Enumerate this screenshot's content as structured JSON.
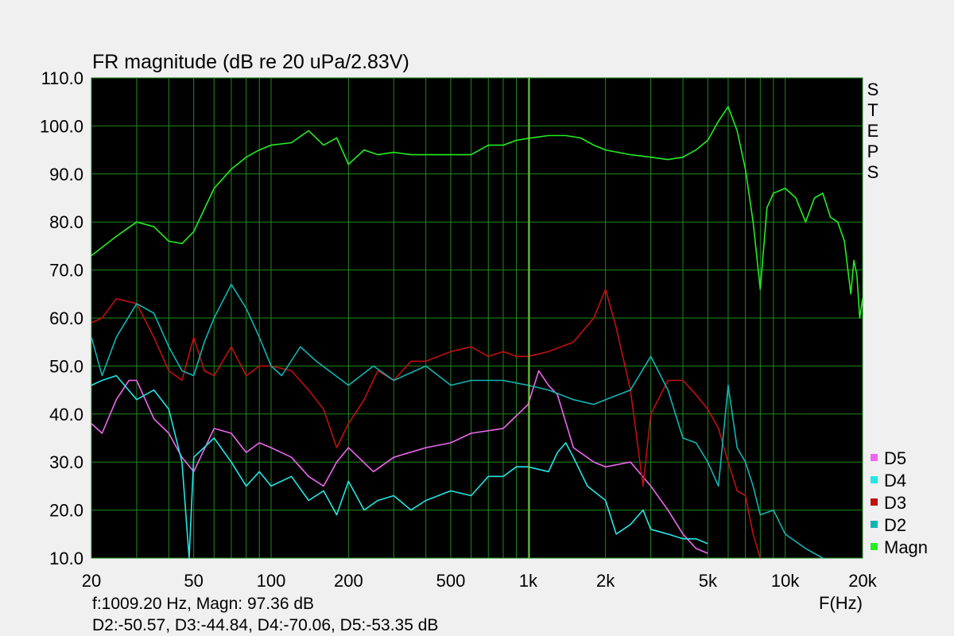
{
  "chart_data": {
    "type": "line",
    "title": "FR magnitude (dB re 20 uPa/2.83V)",
    "xlabel": "F(Hz)",
    "ylabel": "",
    "x_scale": "log",
    "xlim": [
      20,
      20000
    ],
    "ylim": [
      10,
      110
    ],
    "x_ticks": [
      {
        "value": 20,
        "label": "20"
      },
      {
        "value": 50,
        "label": "50"
      },
      {
        "value": 100,
        "label": "100"
      },
      {
        "value": 200,
        "label": "200"
      },
      {
        "value": 500,
        "label": "500"
      },
      {
        "value": 1000,
        "label": "1k"
      },
      {
        "value": 2000,
        "label": "2k"
      },
      {
        "value": 5000,
        "label": "5k"
      },
      {
        "value": 10000,
        "label": "10k"
      },
      {
        "value": 20000,
        "label": "20k"
      }
    ],
    "y_ticks": [
      {
        "value": 110,
        "label": "110.0"
      },
      {
        "value": 100,
        "label": "100.0"
      },
      {
        "value": 90,
        "label": "90.0"
      },
      {
        "value": 80,
        "label": "80.0"
      },
      {
        "value": 70,
        "label": "70.0"
      },
      {
        "value": 60,
        "label": "60.0"
      },
      {
        "value": 50,
        "label": "50.0"
      },
      {
        "value": 40,
        "label": "40.0"
      },
      {
        "value": 30,
        "label": "30.0"
      },
      {
        "value": 20,
        "label": "20.0"
      },
      {
        "value": 10,
        "label": "10.0"
      }
    ],
    "grid": true,
    "background_color": "#000000",
    "grid_color": "#1f8a1f",
    "legend_position": "bottom-right",
    "steps_label": "STEPS",
    "cursor": {
      "x": 1009.2,
      "color": "#9acd32"
    },
    "status_line1": "f:1009.20 Hz, Magn: 97.36 dB",
    "status_line2": "D2:-50.57, D3:-44.84, D4:-70.06, D5:-53.35 dB",
    "series": [
      {
        "name": "Magn",
        "color": "#22ee22",
        "points": [
          [
            20,
            73
          ],
          [
            25,
            77
          ],
          [
            30,
            80
          ],
          [
            35,
            79
          ],
          [
            40,
            76
          ],
          [
            45,
            75.5
          ],
          [
            50,
            78
          ],
          [
            60,
            87
          ],
          [
            70,
            91
          ],
          [
            80,
            93.5
          ],
          [
            90,
            95
          ],
          [
            100,
            96
          ],
          [
            120,
            96.5
          ],
          [
            140,
            99
          ],
          [
            160,
            96
          ],
          [
            180,
            97.5
          ],
          [
            200,
            92
          ],
          [
            230,
            95
          ],
          [
            260,
            94
          ],
          [
            300,
            94.5
          ],
          [
            350,
            94
          ],
          [
            400,
            94
          ],
          [
            450,
            94
          ],
          [
            500,
            94
          ],
          [
            600,
            94
          ],
          [
            700,
            96
          ],
          [
            800,
            96
          ],
          [
            900,
            97
          ],
          [
            1000,
            97.4
          ],
          [
            1200,
            98
          ],
          [
            1400,
            98
          ],
          [
            1600,
            97.5
          ],
          [
            1800,
            96
          ],
          [
            2000,
            95
          ],
          [
            2500,
            94
          ],
          [
            3000,
            93.5
          ],
          [
            3500,
            93
          ],
          [
            4000,
            93.5
          ],
          [
            4500,
            95
          ],
          [
            5000,
            97
          ],
          [
            5500,
            101
          ],
          [
            6000,
            104
          ],
          [
            6500,
            99
          ],
          [
            7000,
            91
          ],
          [
            7500,
            80
          ],
          [
            8000,
            66
          ],
          [
            8500,
            83
          ],
          [
            9000,
            86
          ],
          [
            10000,
            87
          ],
          [
            11000,
            85
          ],
          [
            12000,
            80
          ],
          [
            13000,
            85
          ],
          [
            14000,
            86
          ],
          [
            15000,
            81
          ],
          [
            16000,
            80
          ],
          [
            17000,
            76
          ],
          [
            18000,
            65
          ],
          [
            18500,
            72
          ],
          [
            19000,
            69
          ],
          [
            19500,
            60
          ],
          [
            20000,
            64
          ]
        ]
      },
      {
        "name": "D2",
        "color": "#11b4b4",
        "points": [
          [
            20,
            56
          ],
          [
            22,
            48
          ],
          [
            25,
            56
          ],
          [
            30,
            63
          ],
          [
            35,
            61
          ],
          [
            40,
            54
          ],
          [
            45,
            49
          ],
          [
            50,
            48
          ],
          [
            55,
            55
          ],
          [
            60,
            60
          ],
          [
            70,
            67
          ],
          [
            80,
            62
          ],
          [
            90,
            56
          ],
          [
            100,
            50
          ],
          [
            110,
            48
          ],
          [
            130,
            54
          ],
          [
            150,
            51
          ],
          [
            200,
            46
          ],
          [
            250,
            50
          ],
          [
            300,
            47
          ],
          [
            400,
            50
          ],
          [
            500,
            46
          ],
          [
            600,
            47
          ],
          [
            800,
            47
          ],
          [
            1000,
            46
          ],
          [
            1200,
            45
          ],
          [
            1500,
            43
          ],
          [
            1800,
            42
          ],
          [
            2000,
            43
          ],
          [
            2500,
            45
          ],
          [
            3000,
            52
          ],
          [
            3500,
            45
          ],
          [
            4000,
            35
          ],
          [
            4500,
            34
          ],
          [
            5000,
            30
          ],
          [
            5500,
            25
          ],
          [
            6000,
            46
          ],
          [
            6500,
            33
          ],
          [
            7000,
            30
          ],
          [
            7500,
            25
          ],
          [
            8000,
            19
          ],
          [
            9000,
            20
          ],
          [
            10000,
            15
          ],
          [
            12000,
            12
          ],
          [
            14000,
            10
          ]
        ]
      },
      {
        "name": "D3",
        "color": "#c01010",
        "points": [
          [
            20,
            59
          ],
          [
            22,
            60
          ],
          [
            25,
            64
          ],
          [
            30,
            63
          ],
          [
            35,
            56
          ],
          [
            40,
            49
          ],
          [
            45,
            47
          ],
          [
            50,
            56
          ],
          [
            55,
            49
          ],
          [
            60,
            48
          ],
          [
            70,
            54
          ],
          [
            80,
            48
          ],
          [
            90,
            50
          ],
          [
            100,
            50
          ],
          [
            120,
            49
          ],
          [
            140,
            45
          ],
          [
            160,
            41
          ],
          [
            180,
            33
          ],
          [
            200,
            38
          ],
          [
            230,
            43
          ],
          [
            260,
            49
          ],
          [
            300,
            47
          ],
          [
            350,
            51
          ],
          [
            400,
            51
          ],
          [
            500,
            53
          ],
          [
            600,
            54
          ],
          [
            700,
            52
          ],
          [
            800,
            53
          ],
          [
            900,
            52
          ],
          [
            1000,
            52
          ],
          [
            1200,
            53
          ],
          [
            1500,
            55
          ],
          [
            1800,
            60
          ],
          [
            2000,
            66
          ],
          [
            2200,
            58
          ],
          [
            2500,
            45
          ],
          [
            2800,
            25
          ],
          [
            3000,
            40
          ],
          [
            3500,
            47
          ],
          [
            4000,
            47
          ],
          [
            4500,
            44
          ],
          [
            5000,
            41
          ],
          [
            5500,
            37
          ],
          [
            6000,
            30
          ],
          [
            6500,
            24
          ],
          [
            7000,
            23
          ],
          [
            7500,
            15
          ],
          [
            8000,
            10
          ]
        ]
      },
      {
        "name": "D4",
        "color": "#22e6e6",
        "points": [
          [
            20,
            46
          ],
          [
            22,
            47
          ],
          [
            25,
            48
          ],
          [
            30,
            43
          ],
          [
            35,
            45
          ],
          [
            40,
            41
          ],
          [
            45,
            30
          ],
          [
            48,
            10
          ],
          [
            50,
            31
          ],
          [
            60,
            35
          ],
          [
            70,
            30
          ],
          [
            80,
            25
          ],
          [
            90,
            28
          ],
          [
            100,
            25
          ],
          [
            120,
            27
          ],
          [
            140,
            22
          ],
          [
            160,
            24
          ],
          [
            180,
            19
          ],
          [
            200,
            26
          ],
          [
            230,
            20
          ],
          [
            260,
            22
          ],
          [
            300,
            23
          ],
          [
            350,
            20
          ],
          [
            400,
            22
          ],
          [
            500,
            24
          ],
          [
            600,
            23
          ],
          [
            700,
            27
          ],
          [
            800,
            27
          ],
          [
            900,
            29
          ],
          [
            1000,
            29
          ],
          [
            1200,
            28
          ],
          [
            1300,
            32
          ],
          [
            1400,
            34
          ],
          [
            1500,
            31
          ],
          [
            1700,
            25
          ],
          [
            2000,
            22
          ],
          [
            2200,
            15
          ],
          [
            2500,
            17
          ],
          [
            2800,
            20
          ],
          [
            3000,
            16
          ],
          [
            3500,
            15
          ],
          [
            4000,
            14
          ],
          [
            4500,
            14
          ],
          [
            5000,
            13
          ]
        ]
      },
      {
        "name": "D5",
        "color": "#ee66ee",
        "points": [
          [
            20,
            38
          ],
          [
            22,
            36
          ],
          [
            25,
            43
          ],
          [
            28,
            47
          ],
          [
            30,
            47
          ],
          [
            35,
            39
          ],
          [
            40,
            36
          ],
          [
            45,
            31
          ],
          [
            50,
            28
          ],
          [
            60,
            37
          ],
          [
            70,
            36
          ],
          [
            80,
            32
          ],
          [
            90,
            34
          ],
          [
            100,
            33
          ],
          [
            120,
            31
          ],
          [
            140,
            27
          ],
          [
            160,
            25
          ],
          [
            180,
            30
          ],
          [
            200,
            33
          ],
          [
            250,
            28
          ],
          [
            300,
            31
          ],
          [
            400,
            33
          ],
          [
            500,
            34
          ],
          [
            600,
            36
          ],
          [
            800,
            37
          ],
          [
            1000,
            42
          ],
          [
            1100,
            49
          ],
          [
            1200,
            46
          ],
          [
            1300,
            44
          ],
          [
            1500,
            33
          ],
          [
            1800,
            30
          ],
          [
            2000,
            29
          ],
          [
            2500,
            30
          ],
          [
            3000,
            25
          ],
          [
            3500,
            20
          ],
          [
            4000,
            15
          ],
          [
            4500,
            12
          ],
          [
            5000,
            11
          ]
        ]
      }
    ],
    "legend": [
      {
        "name": "D5",
        "color": "#ee66ee"
      },
      {
        "name": "D4",
        "color": "#22e6e6"
      },
      {
        "name": "D3",
        "color": "#c01010"
      },
      {
        "name": "D2",
        "color": "#11b4b4"
      },
      {
        "name": "Magn",
        "color": "#22ee22"
      }
    ]
  }
}
